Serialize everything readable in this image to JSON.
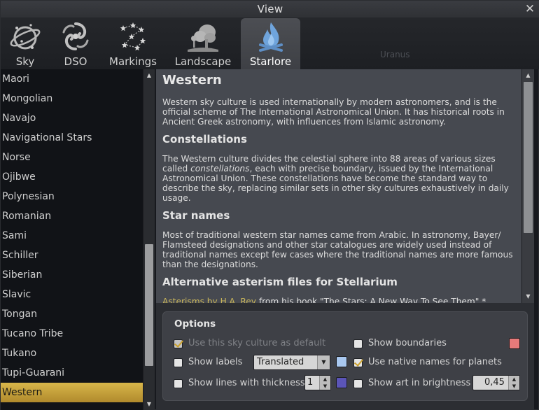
{
  "window": {
    "title": "View",
    "close_glyph": "✕"
  },
  "tabs": [
    {
      "label": "Sky",
      "icon": "sky-icon"
    },
    {
      "label": "DSO",
      "icon": "galaxy-icon"
    },
    {
      "label": "Markings",
      "icon": "constellation-icon"
    },
    {
      "label": "Landscape",
      "icon": "tree-icon"
    },
    {
      "label": "Starlore",
      "icon": "campfire-icon",
      "active": true
    }
  ],
  "background_label": "Uranus",
  "sky_cultures": [
    "Maori",
    "Mongolian",
    "Navajo",
    "Navigational Stars",
    "Norse",
    "Ojibwe",
    "Polynesian",
    "Romanian",
    "Sami",
    "Schiller",
    "Siberian",
    "Slavic",
    "Tongan",
    "Tucano Tribe",
    "Tukano",
    "Tupi-Guarani",
    "Western"
  ],
  "selected_culture": "Western",
  "description": {
    "title": "Western",
    "intro": "Western sky culture is used internationally by modern astronomers, and is the official scheme of The International Astronomical Union. It has historical roots in Ancient Greek astronomy, with influences from Islamic astronomy.",
    "constellations_heading": "Constellations",
    "constellations_text_1": "The Western culture divides the celestial sphere into 88 areas of various sizes called ",
    "constellations_text_em": "constellations",
    "constellations_text_2": ", each with precise boundary, issued by the International Astronomical Union. These constellations have become the standard way to describe the sky, replacing similar sets in other sky cultures exhaustively in daily usage.",
    "star_names_heading": "Star names",
    "star_names_text": "Most of traditional western star names came from Arabic. In astronomy, Bayer/ Flamsteed designations and other star catalogues are widely used instead of traditional names except few cases where the traditional names are more famous than the designations.",
    "alt_heading": "Alternative asterism files for Stellarium",
    "alt_link": "Asterisms by H.A. Rey",
    "alt_text": " from his book \"The Stars: A New Way To See Them\" *"
  },
  "options": {
    "title": "Options",
    "use_default_label": "Use this sky culture as default",
    "use_default_checked": true,
    "show_boundaries_label": "Show boundaries",
    "show_boundaries_checked": false,
    "boundaries_color": "#e87a7a",
    "show_labels_label": "Show labels",
    "show_labels_checked": false,
    "labels_mode": "Translated",
    "labels_color": "#a9c8f0",
    "native_names_label": "Use native names for planets",
    "native_names_checked": true,
    "show_lines_label": "Show lines with thickness",
    "show_lines_checked": false,
    "line_thickness": "1",
    "lines_color": "#5b55b8",
    "show_art_label": "Show art in brightness",
    "show_art_checked": false,
    "art_brightness": "0,45"
  },
  "glyphs": {
    "up": "▲",
    "down": "▼"
  }
}
